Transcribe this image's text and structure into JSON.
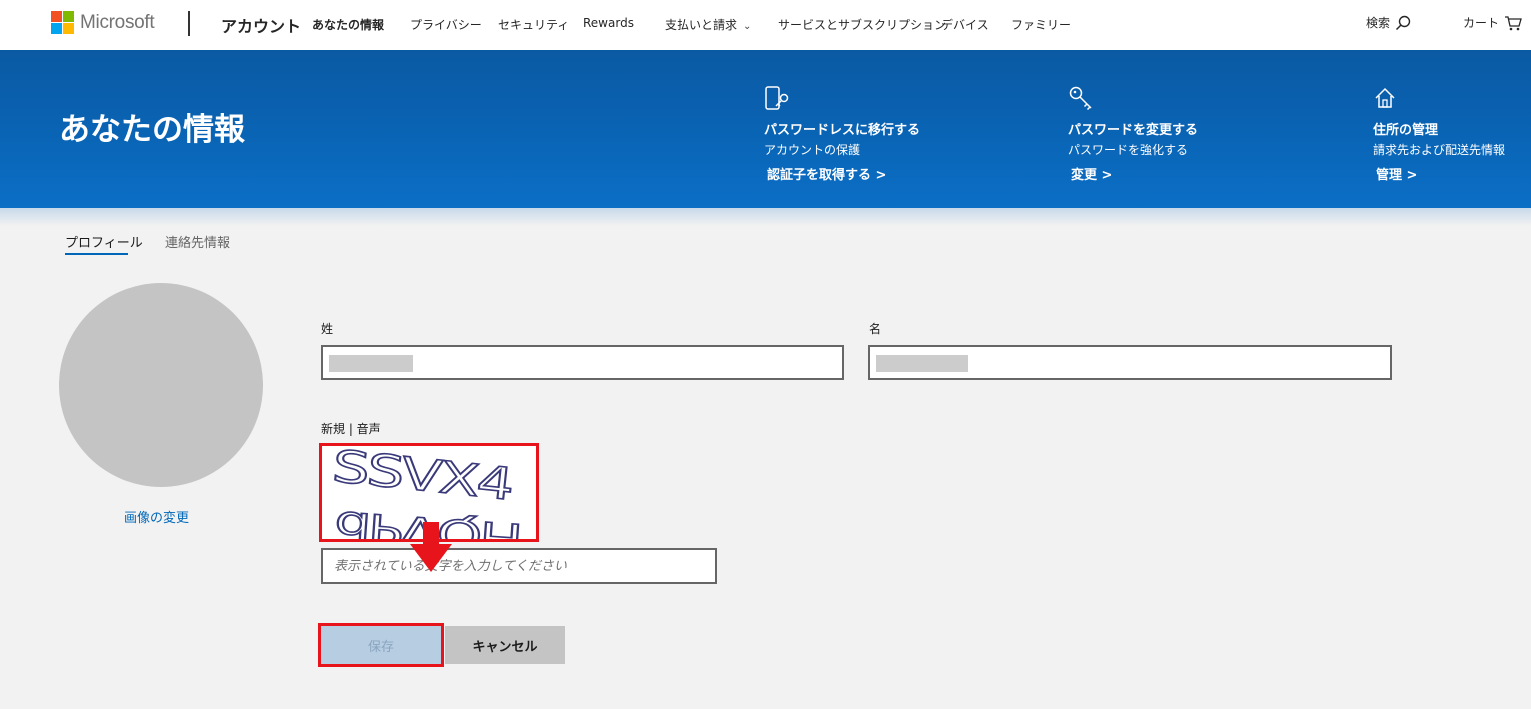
{
  "header": {
    "brand": "Microsoft",
    "section": "アカウント",
    "nav": [
      {
        "label": "あなたの情報"
      },
      {
        "label": "プライバシー"
      },
      {
        "label": "セキュリティ"
      },
      {
        "label": "Rewards"
      },
      {
        "label": "支払いと請求"
      },
      {
        "label": "サービスとサブスクリプション"
      },
      {
        "label": "デバイス"
      },
      {
        "label": "ファミリー"
      }
    ],
    "search_label": "検索",
    "cart_label": "カート"
  },
  "banner": {
    "title": "あなたの情報",
    "cards": [
      {
        "heading": "パスワードレスに移行する",
        "sub": "アカウントの保護",
        "link": "認証子を取得する >"
      },
      {
        "heading": "パスワードを変更する",
        "sub": "パスワードを強化する",
        "link": "変更 >"
      },
      {
        "heading": "住所の管理",
        "sub": "請求先および配送先情報",
        "link": "管理 >"
      }
    ]
  },
  "tabs": [
    {
      "label": "プロフィール"
    },
    {
      "label": "連絡先情報"
    }
  ],
  "profile": {
    "change_image": "画像の変更"
  },
  "form": {
    "last_name_label": "姓",
    "first_name_label": "名",
    "captcha_label": "新規 | 音声",
    "captcha_text_line1": "SSVX4",
    "captcha_text_line2": "dPVQH",
    "captcha_placeholder": "表示されている文字を入力してください",
    "save_label": "保存",
    "cancel_label": "キャンセル"
  },
  "colors": {
    "ms_red": "#f25022",
    "ms_green": "#7fba00",
    "ms_blue": "#00a4ef",
    "ms_yellow": "#ffb900",
    "accent": "#0067b8",
    "highlight": "#e8141c"
  }
}
